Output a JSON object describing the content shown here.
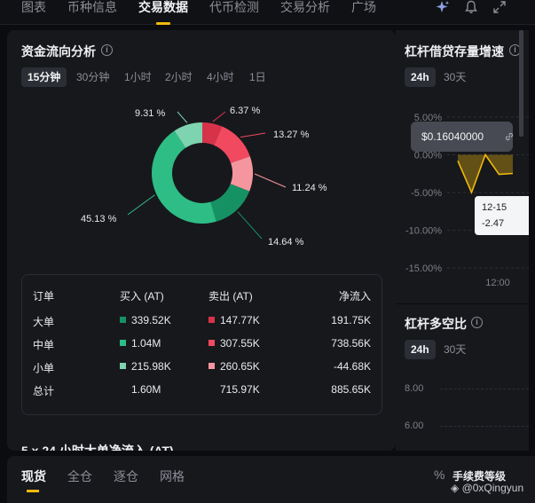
{
  "top_tabs": [
    {
      "label": "图表"
    },
    {
      "label": "币种信息"
    },
    {
      "label": "交易数据"
    },
    {
      "label": "代币检测"
    },
    {
      "label": "交易分析"
    },
    {
      "label": "广场"
    }
  ],
  "top_icons": [
    "sparkle-icon",
    "bell-icon",
    "expand-icon"
  ],
  "money_flow": {
    "title": "资金流向分析",
    "timeframes": [
      "15分钟",
      "30分钟",
      "1小时",
      "2小时",
      "4小时",
      "1日"
    ],
    "active_timeframe": "15分钟",
    "donut": {
      "slices": [
        {
          "label": "6.37 %",
          "value": 6.37,
          "color": "#d6334a"
        },
        {
          "label": "13.27 %",
          "value": 13.27,
          "color": "#f1495f"
        },
        {
          "label": "11.24 %",
          "value": 11.24,
          "color": "#f5969f"
        },
        {
          "label": "14.64 %",
          "value": 14.64,
          "color": "#169164"
        },
        {
          "label": "45.13 %",
          "value": 45.13,
          "color": "#2ebd85"
        },
        {
          "label": "9.31 %",
          "value": 9.31,
          "color": "#7dd4ae"
        }
      ]
    },
    "table": {
      "headers": [
        "订单",
        "买入 (AT)",
        "卖出 (AT)",
        "净流入"
      ],
      "rows": [
        {
          "label": "大单",
          "buy": "339.52K",
          "sell": "147.77K",
          "net": "191.75K",
          "buy_color": "#169164",
          "sell_color": "#d6334a"
        },
        {
          "label": "中单",
          "buy": "1.04M",
          "sell": "307.55K",
          "net": "738.56K",
          "buy_color": "#2ebd85",
          "sell_color": "#f1495f"
        },
        {
          "label": "小单",
          "buy": "215.98K",
          "sell": "260.65K",
          "net": "-44.68K",
          "buy_color": "#7dd4ae",
          "sell_color": "#f5969f"
        },
        {
          "label": "总计",
          "buy": "1.60M",
          "sell": "715.97K",
          "net": "885.65K"
        }
      ]
    },
    "next_section_title": "5 x 24 小时大单净流入 (AT)"
  },
  "leverage_growth": {
    "title": "杠杆借贷存量增速",
    "tabs": [
      "24h",
      "30天"
    ],
    "active_tab": "24h",
    "price_tag": "$0.16040000",
    "chart_data": {
      "type": "area",
      "y_tick_labels": [
        "5.00%",
        "0.00%",
        "-5.00%",
        "-10.00%",
        "-15.00%"
      ],
      "x_tick_labels": [
        "12:00"
      ],
      "ylim": [
        -15,
        5
      ],
      "series": [
        {
          "values": [
            -0.8,
            -5.0,
            0.0,
            -2.6,
            -2.47
          ],
          "color": "#f0b90b"
        }
      ],
      "tooltip": {
        "date": "12-15",
        "value": "-2.47"
      }
    }
  },
  "long_short": {
    "title": "杠杆多空比",
    "tabs": [
      "24h",
      "30天"
    ],
    "active_tab": "24h",
    "y_tick_labels": [
      "8.00",
      "6.00"
    ]
  },
  "bottom": {
    "tabs": [
      "现货",
      "全仓",
      "逐仓",
      "网格"
    ],
    "active_tab": "现货",
    "fee_label": "手续费等级",
    "watermark": "@0xQingyun"
  }
}
